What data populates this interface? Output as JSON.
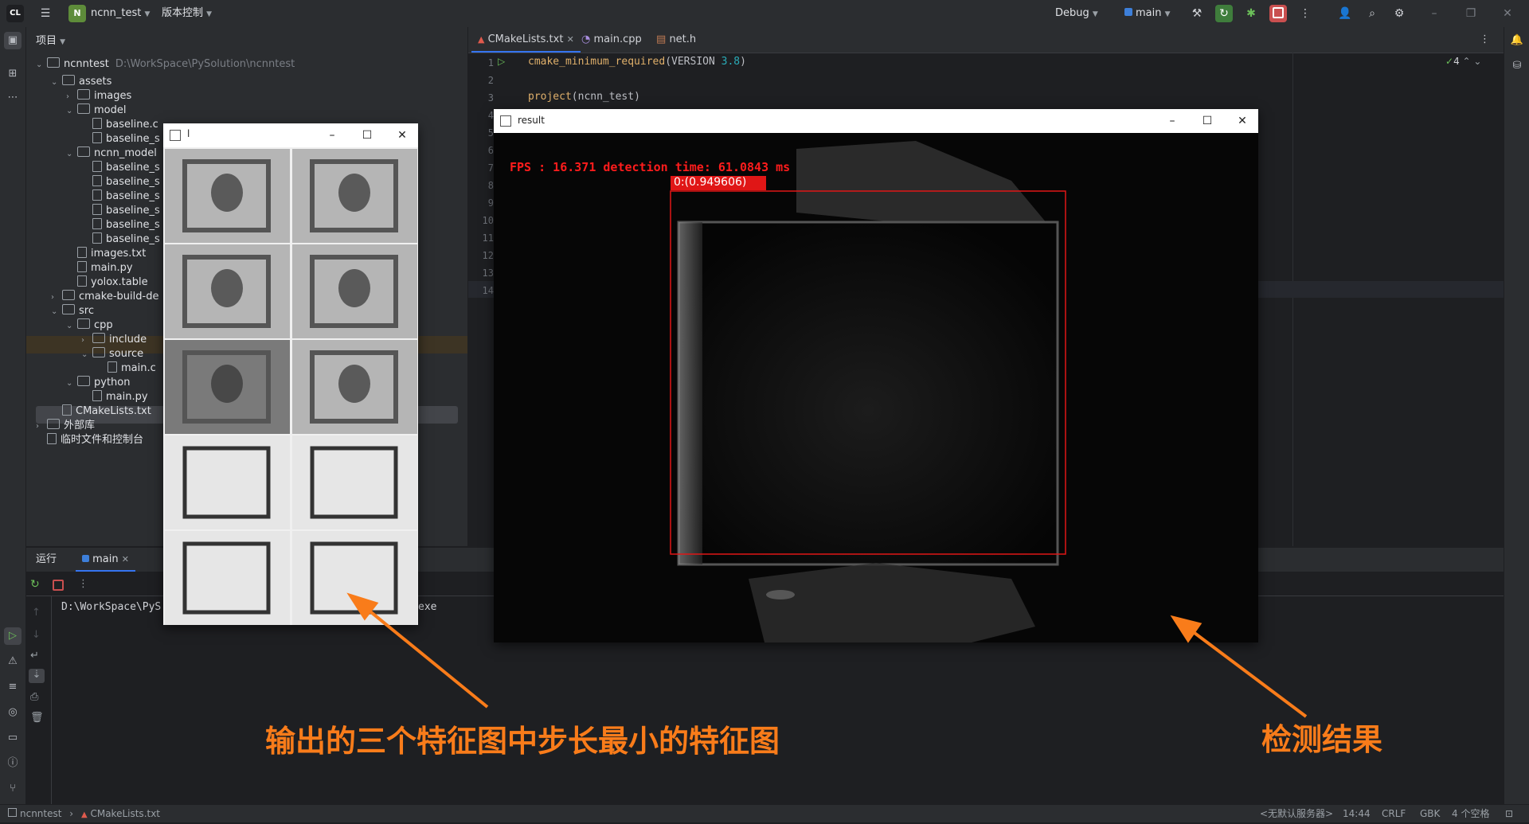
{
  "toolbar": {
    "app_icon": "CL",
    "menu_icon": "hamburger-icon",
    "project_badge": "N",
    "project_name": "ncnn_test",
    "vcs_label": "版本控制",
    "config": "Debug",
    "target": "main"
  },
  "project_panel": {
    "title": "项目",
    "root": "ncnntest",
    "root_path": "D:\\WorkSpace\\PySolution\\ncnntest",
    "items": [
      {
        "label": "assets",
        "indent": 1,
        "type": "folder",
        "open": true
      },
      {
        "label": "images",
        "indent": 2,
        "type": "folder",
        "open": false
      },
      {
        "label": "model",
        "indent": 2,
        "type": "folder",
        "open": true
      },
      {
        "label": "baseline.c",
        "indent": 3,
        "type": "file"
      },
      {
        "label": "baseline_s",
        "indent": 3,
        "type": "file"
      },
      {
        "label": "ncnn_model",
        "indent": 2,
        "type": "folder",
        "open": true
      },
      {
        "label": "baseline_s",
        "indent": 3,
        "type": "file"
      },
      {
        "label": "baseline_s",
        "indent": 3,
        "type": "file"
      },
      {
        "label": "baseline_s",
        "indent": 3,
        "type": "file"
      },
      {
        "label": "baseline_s",
        "indent": 3,
        "type": "file"
      },
      {
        "label": "baseline_s",
        "indent": 3,
        "type": "file"
      },
      {
        "label": "baseline_s",
        "indent": 3,
        "type": "file"
      },
      {
        "label": "images.txt",
        "indent": 2,
        "type": "file"
      },
      {
        "label": "main.py",
        "indent": 2,
        "type": "file"
      },
      {
        "label": "yolox.table",
        "indent": 2,
        "type": "file"
      },
      {
        "label": "cmake-build-de",
        "indent": 1,
        "type": "folder",
        "open": false
      },
      {
        "label": "src",
        "indent": 1,
        "type": "folder",
        "open": true
      },
      {
        "label": "cpp",
        "indent": 2,
        "type": "folder",
        "open": true
      },
      {
        "label": "include",
        "indent": 3,
        "type": "folder",
        "open": false
      },
      {
        "label": "source",
        "indent": 3,
        "type": "folder",
        "open": true
      },
      {
        "label": "main.c",
        "indent": 4,
        "type": "file"
      },
      {
        "label": "python",
        "indent": 2,
        "type": "folder",
        "open": true
      },
      {
        "label": "main.py",
        "indent": 3,
        "type": "file"
      },
      {
        "label": "CMakeLists.txt",
        "indent": 1,
        "type": "file"
      },
      {
        "label": "外部库",
        "indent": 0,
        "type": "folder",
        "open": false
      },
      {
        "label": "临时文件和控制台",
        "indent": 0,
        "type": "file"
      }
    ]
  },
  "editor": {
    "tabs": [
      {
        "label": "CMakeLists.txt",
        "active": true
      },
      {
        "label": "main.cpp",
        "active": false
      },
      {
        "label": "net.h",
        "active": false
      }
    ],
    "check_count": "4",
    "line_numbers": [
      "1",
      "2",
      "3",
      "4",
      "5",
      "6",
      "7",
      "8",
      "9",
      "10",
      "11",
      "12",
      "13",
      "14"
    ],
    "line1_fn": "cmake_minimum_required",
    "line1_arg": "(VERSION ",
    "line1_ver": "3.8",
    "line1_end": ")",
    "line3_fn": "project",
    "line3_arg": "(ncnn_test)"
  },
  "run_panel": {
    "tab_label": "运行",
    "config_tab": "main",
    "console_prefix": "D:\\WorkSpace\\PyS",
    "console_suffix": "exe"
  },
  "feature_window": {
    "title": "l"
  },
  "result_window": {
    "title": "result",
    "fps_text": "FPS : 16.371  detection time: 61.0843 ms",
    "label": "0:(0.949606)"
  },
  "annotations": {
    "left": "输出的三个特征图中步长最小的特征图",
    "right": "检测结果",
    "color": "#f97c1a"
  },
  "status_bar": {
    "crumb_root": "ncnntest",
    "crumb_file": "CMakeLists.txt",
    "server": "<无默认服务器>",
    "position": "14:44",
    "line_sep": "CRLF",
    "encoding": "GBK",
    "indent": "4 个空格"
  }
}
